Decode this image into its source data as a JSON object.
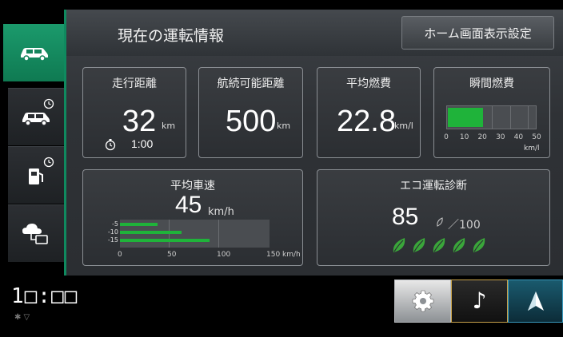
{
  "header": {
    "title": "現在の運転情報",
    "home_button_label": "ホーム画面表示設定"
  },
  "sidebar": {
    "tabs": [
      {
        "icon": "car-icon",
        "active": true
      },
      {
        "icon": "car-clock-icon",
        "active": false
      },
      {
        "icon": "fuel-clock-icon",
        "active": false
      },
      {
        "icon": "cloud-connect-icon",
        "active": false
      }
    ]
  },
  "cards": {
    "distance": {
      "title": "走行距離",
      "value": "32",
      "unit": "km",
      "time": "1:00"
    },
    "range": {
      "title": "航続可能距離",
      "value": "500",
      "unit": "km"
    },
    "avg_fuel": {
      "title": "平均燃費",
      "value": "22.8",
      "unit": "km/l"
    },
    "instant_fuel": {
      "title": "瞬間燃費",
      "ticks": [
        "0",
        "10",
        "20",
        "30",
        "40",
        "50"
      ],
      "unit": "km/l",
      "value_fraction": 0.4
    },
    "avg_speed": {
      "title": "平均車速",
      "value": "45",
      "unit": "km/h",
      "rows": [
        {
          "label": "-5",
          "value_fraction": 0.25
        },
        {
          "label": "-10",
          "value_fraction": 0.41
        },
        {
          "label": "-15",
          "value_fraction": 0.6
        }
      ],
      "ticks": [
        "0",
        "50",
        "100",
        "150 km/h"
      ]
    },
    "eco": {
      "title": "エコ運転診断",
      "score": "85",
      "max_label": "／100",
      "leaf_count": 5
    }
  },
  "status": {
    "clock": "1□:□□",
    "icons": "✱ ▽"
  },
  "quick_buttons": [
    {
      "name": "settings",
      "icon": "gear-icon"
    },
    {
      "name": "audio",
      "icon": "music-note-icon"
    },
    {
      "name": "navigation",
      "icon": "navigation-arrow-icon"
    }
  ],
  "colors": {
    "accent_green": "#0f8a5f",
    "bar_green": "#1fb33a",
    "leaf_green": "#3aa63a",
    "panel_bg": "#2f3236"
  }
}
